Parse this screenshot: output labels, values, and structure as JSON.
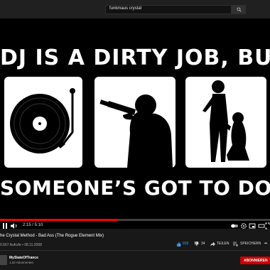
{
  "search": {
    "query": "funkmaus crystal"
  },
  "video": {
    "headline_top": "DJ IS A DIRTY JOB, BUT",
    "headline_bottom": "SOMEONE’S GOT TO DO IT",
    "current_time": "2:15 / 5:10",
    "progress_fraction": 0.435
  },
  "info": {
    "title": "he Crystal Method - Bad Ass (The Rogue Element Mix)",
    "meta": "9.567 Aufrufe • 08.11.2008",
    "likes": "915",
    "dislikes": "34",
    "share_label": "TEILEN",
    "save_label": "SPEICHERN"
  },
  "channel": {
    "name": "MyStateOfTrance",
    "subscribers": "1,02 Abonnenten",
    "subscribe_label": "ABONNIEREN"
  },
  "colors": {
    "accent": "#ff0000",
    "subscribe": "#cc0000",
    "like": "#3ea6ff"
  }
}
